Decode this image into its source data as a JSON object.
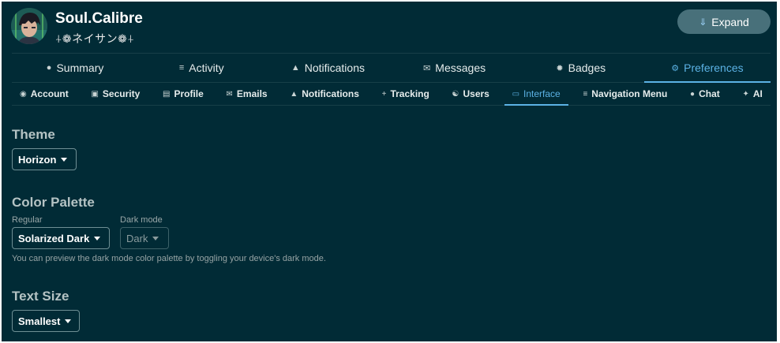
{
  "header": {
    "username": "Soul.Calibre",
    "nickname": "⍭❁ネイサン❁⍭",
    "expand_label": "Expand"
  },
  "primary_tabs": [
    {
      "label": "Summary",
      "icon": "user-icon"
    },
    {
      "label": "Activity",
      "icon": "list-icon"
    },
    {
      "label": "Notifications",
      "icon": "bell-icon"
    },
    {
      "label": "Messages",
      "icon": "envelope-icon"
    },
    {
      "label": "Badges",
      "icon": "badge-icon"
    },
    {
      "label": "Preferences",
      "icon": "gear-icon",
      "active": true
    }
  ],
  "secondary_tabs": [
    {
      "label": "Account",
      "icon": "account-icon"
    },
    {
      "label": "Security",
      "icon": "lock-icon"
    },
    {
      "label": "Profile",
      "icon": "id-card-icon"
    },
    {
      "label": "Emails",
      "icon": "envelope-icon"
    },
    {
      "label": "Notifications",
      "icon": "bell-icon"
    },
    {
      "label": "Tracking",
      "icon": "plus-icon"
    },
    {
      "label": "Users",
      "icon": "users-icon"
    },
    {
      "label": "Interface",
      "icon": "monitor-icon",
      "active": true
    },
    {
      "label": "Navigation Menu",
      "icon": "menu-icon"
    },
    {
      "label": "Chat",
      "icon": "chat-icon"
    },
    {
      "label": "AI",
      "icon": "sparkle-icon"
    }
  ],
  "theme": {
    "title": "Theme",
    "value": "Horizon"
  },
  "color_palette": {
    "title": "Color Palette",
    "regular_label": "Regular",
    "regular_value": "Solarized Dark",
    "dark_label": "Dark mode",
    "dark_value": "Dark",
    "hint": "You can preview the dark mode color palette by toggling your device's dark mode."
  },
  "text_size": {
    "title": "Text Size",
    "value": "Smallest"
  },
  "colors": {
    "background": "#012b36",
    "accent": "#5cb2e5",
    "expand_button": "#48707a"
  }
}
